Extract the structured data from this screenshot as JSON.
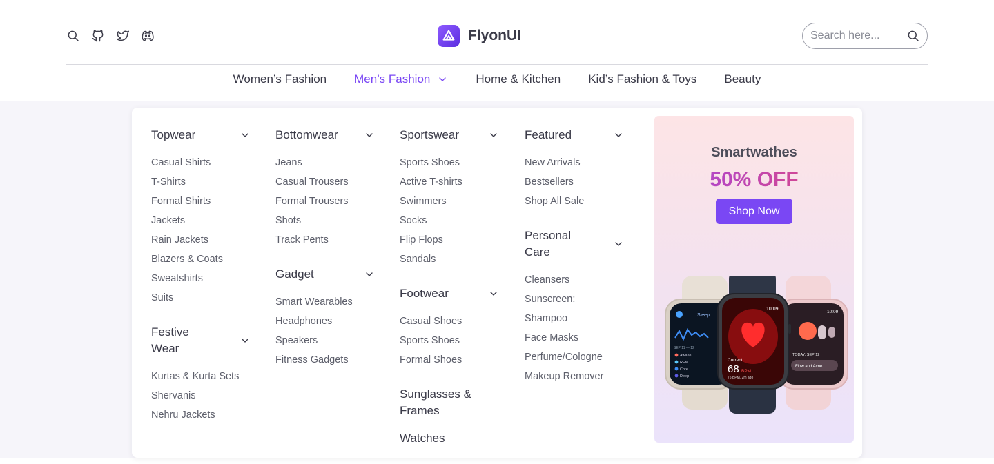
{
  "header": {
    "left_icons": [
      "search-icon",
      "github-icon",
      "twitter-icon",
      "discord-icon"
    ],
    "brand_name": "FlyonUI",
    "search_placeholder": "Search here..."
  },
  "nav": {
    "items": [
      {
        "label": "Women’s Fashion",
        "active": false
      },
      {
        "label": "Men’s Fashion",
        "active": true
      },
      {
        "label": "Home & Kitchen",
        "active": false
      },
      {
        "label": "Kid’s Fashion & Toys",
        "active": false
      },
      {
        "label": "Beauty",
        "active": false
      }
    ]
  },
  "menu": {
    "topwear": {
      "title": "Topwear",
      "links": [
        "Casual Shirts",
        "T-Shirts",
        "Formal Shirts",
        "Jackets",
        "Rain Jackets",
        "Blazers & Coats",
        "Sweatshirts",
        "Suits"
      ]
    },
    "festive": {
      "title_line1": "Festive",
      "title_line2": "Wear",
      "links": [
        "Kurtas & Kurta Sets",
        "Shervanis",
        "Nehru Jackets"
      ]
    },
    "bottomwear": {
      "title": "Bottomwear",
      "links": [
        "Jeans",
        "Casual Trousers",
        "Formal Trousers",
        "Shots",
        "Track Pents"
      ]
    },
    "gadget": {
      "title": "Gadget",
      "links": [
        "Smart Wearables",
        "Headphones",
        "Speakers",
        "Fitness Gadgets"
      ]
    },
    "sportswear": {
      "title": "Sportswear",
      "links": [
        "Sports Shoes",
        "Active T-shirts",
        "Swimmers",
        "Socks",
        "Flip Flops",
        "Sandals"
      ]
    },
    "footwear": {
      "title": "Footwear",
      "links": [
        "Casual Shoes",
        "Sports Shoes",
        "Formal Shoes"
      ]
    },
    "sunglasses": {
      "title_line1": "Sunglasses &",
      "title_line2": "Frames"
    },
    "watches": {
      "title": "Watches"
    },
    "featured": {
      "title": "Featured",
      "links": [
        "New Arrivals",
        "Bestsellers",
        "Shop All Sale"
      ]
    },
    "personal_care": {
      "title_line1": "Personal",
      "title_line2": "Care",
      "links": [
        "Cleansers",
        "Sunscreen:",
        "Shampoo",
        "Face Masks",
        "Perfume/Cologne",
        "Makeup Remover"
      ]
    }
  },
  "promo": {
    "title": "Smartwathes",
    "discount": "50% OFF",
    "button": "Shop Now",
    "watch_left": {
      "label": "Sleep",
      "stats": [
        "SEP 11 — 12",
        "Awake",
        "REM",
        "Core",
        "Deep"
      ]
    },
    "watch_center": {
      "time": "10:09",
      "label": "Current",
      "bpm": "68",
      "unit": "BPM",
      "sub": "75 BPM, 2m ago"
    },
    "watch_right": {
      "time": "10:09",
      "date": "TODAY, SEP 12",
      "label": "Flow and Acne"
    }
  },
  "colors": {
    "accent": "#7a47f4",
    "text": "#3a3a48",
    "muted": "#5d5f6b",
    "backdrop": "#f6f5fa"
  }
}
